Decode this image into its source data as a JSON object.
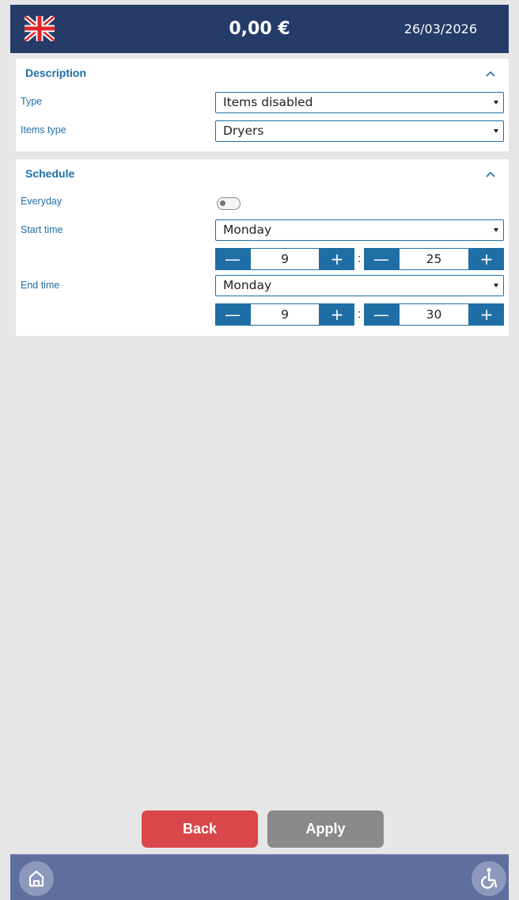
{
  "header": {
    "flag_icon": "uk-flag-icon",
    "balance": "0,00 €",
    "date": "26/03/2026",
    "color": "#243c67"
  },
  "description": {
    "title": "Description",
    "type_label": "Type",
    "type_value": "Items disabled",
    "items_type_label": "Items type",
    "items_type_value": "Dryers"
  },
  "schedule": {
    "title": "Schedule",
    "everyday_label": "Everyday",
    "everyday_on": false,
    "start_label": "Start time",
    "start_day": "Monday",
    "start_hour": "9",
    "start_minute": "25",
    "end_label": "End time",
    "end_day": "Monday",
    "end_hour": "9",
    "end_minute": "30"
  },
  "stepper": {
    "minus": "—",
    "plus": "+",
    "separator": ":"
  },
  "actions": {
    "back_label": "Back",
    "apply_label": "Apply",
    "back_color": "#d9474a",
    "apply_color": "#8a8a8a"
  },
  "footer": {
    "home_icon": "home-icon",
    "accessibility_icon": "accessibility-icon"
  },
  "accent": "#1f6ea6"
}
